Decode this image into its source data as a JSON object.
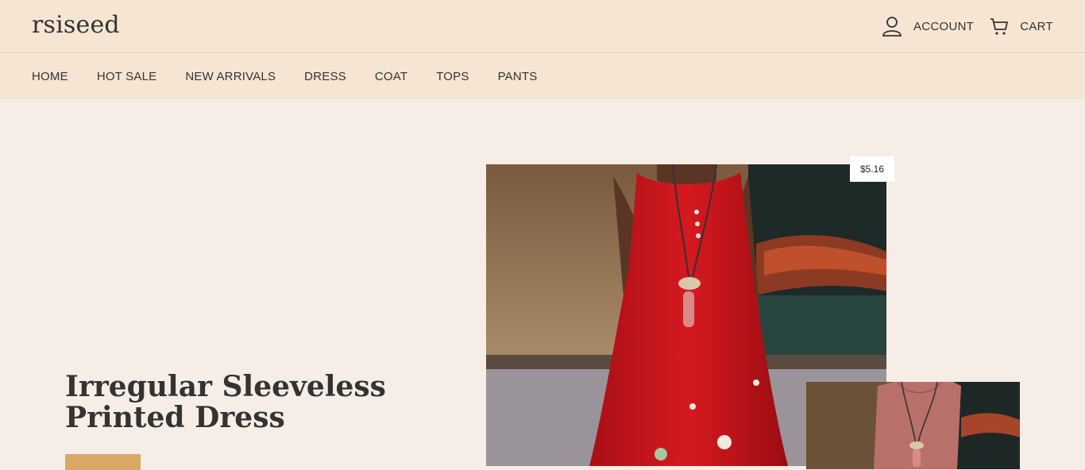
{
  "header": {
    "logo": "rsiseed",
    "account_label": "ACCOUNT",
    "cart_label": "CART"
  },
  "nav": {
    "items": [
      "HOME",
      "HOT SALE",
      "NEW ARRIVALS",
      "DRESS",
      "COAT",
      "TOPS",
      "PANTS"
    ]
  },
  "hero": {
    "title_line1": "Irregular Sleeveless",
    "title_line2": "Printed Dress",
    "price": "$5.16"
  },
  "colors": {
    "header_bg": "#f6e5d2",
    "page_bg": "#f5ede6",
    "accent": "#d8a867",
    "dress_red": "#c8161e"
  }
}
